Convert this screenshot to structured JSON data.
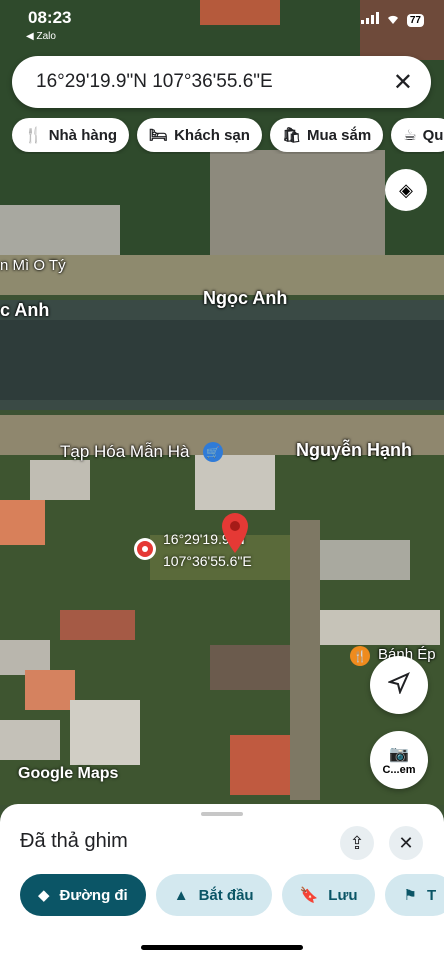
{
  "status": {
    "time": "08:23",
    "back_app": "◀ Zalo",
    "battery": "77"
  },
  "search": {
    "query": "16°29'19.9\"N 107°36'55.6\"E"
  },
  "chips": [
    {
      "icon": "restaurant-icon",
      "label": "Nhà hàng"
    },
    {
      "icon": "hotel-icon",
      "label": "Khách sạn"
    },
    {
      "icon": "shopping-icon",
      "label": "Mua sắm"
    },
    {
      "icon": "cafe-icon",
      "label": "Qu"
    }
  ],
  "map_labels": {
    "mi_o_ty": "n Mì O Tý",
    "ngoc_anh_left": "c Anh",
    "ngoc_anh": "Ngọc Anh",
    "tap_hoa": "Tạp Hóa Mẫn Hà",
    "nguyen_hanh": "Nguyễn Hạnh",
    "banh_ep": "Bánh Ép"
  },
  "pin_coords": {
    "lat": "16°29'19.9\"N",
    "lng": "107°36'55.6\"E"
  },
  "watermark": "Google Maps",
  "camera_label": "C...em",
  "sheet": {
    "title": "Đã thả ghim",
    "actions": [
      {
        "icon": "directions-icon",
        "label": "Đường đi"
      },
      {
        "icon": "navigate-icon",
        "label": "Bắt đầu"
      },
      {
        "icon": "bookmark-icon",
        "label": "Lưu"
      },
      {
        "icon": "flag-icon",
        "label": "T"
      }
    ]
  },
  "colors": {
    "accent": "#0b5566",
    "accent_light": "#d3e8ef",
    "pin": "#e53935"
  }
}
